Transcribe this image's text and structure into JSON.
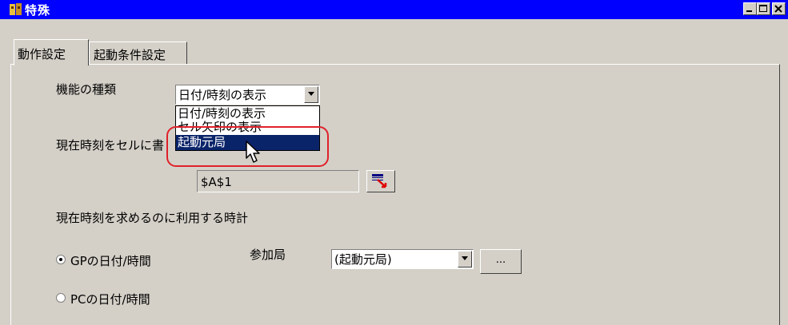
{
  "window": {
    "title": "特殊",
    "minimize_icon": "minimize-icon",
    "maximize_icon": "maximize-icon",
    "close_icon": "close-icon"
  },
  "tabs": [
    {
      "label": "動作設定",
      "active": true
    },
    {
      "label": "起動条件設定",
      "active": false
    }
  ],
  "function_type": {
    "label": "機能の種類",
    "selected": "日付/時刻の表示",
    "options": [
      "日付/時刻の表示",
      "セル矢印の表示",
      "起動元局"
    ],
    "highlighted_option": "起動元局"
  },
  "write_time": {
    "label_visible": "現在時刻をセルに書",
    "cell_value": "$A$1",
    "pick_icon": "cell-picker-icon"
  },
  "clock_source": {
    "label": "現在時刻を求めるのに利用する時計",
    "option_gp": "GPの日付/時間",
    "option_pc": "PCの日付/時間",
    "selected": "GPの日付/時間"
  },
  "station": {
    "label": "参加局",
    "selected": "(起動元局)",
    "browse_label": "..."
  },
  "colors": {
    "titlebar": "#0000ff",
    "face": "#d4d0c8",
    "selection": "#0a246a",
    "annotation": "#e0202a"
  }
}
